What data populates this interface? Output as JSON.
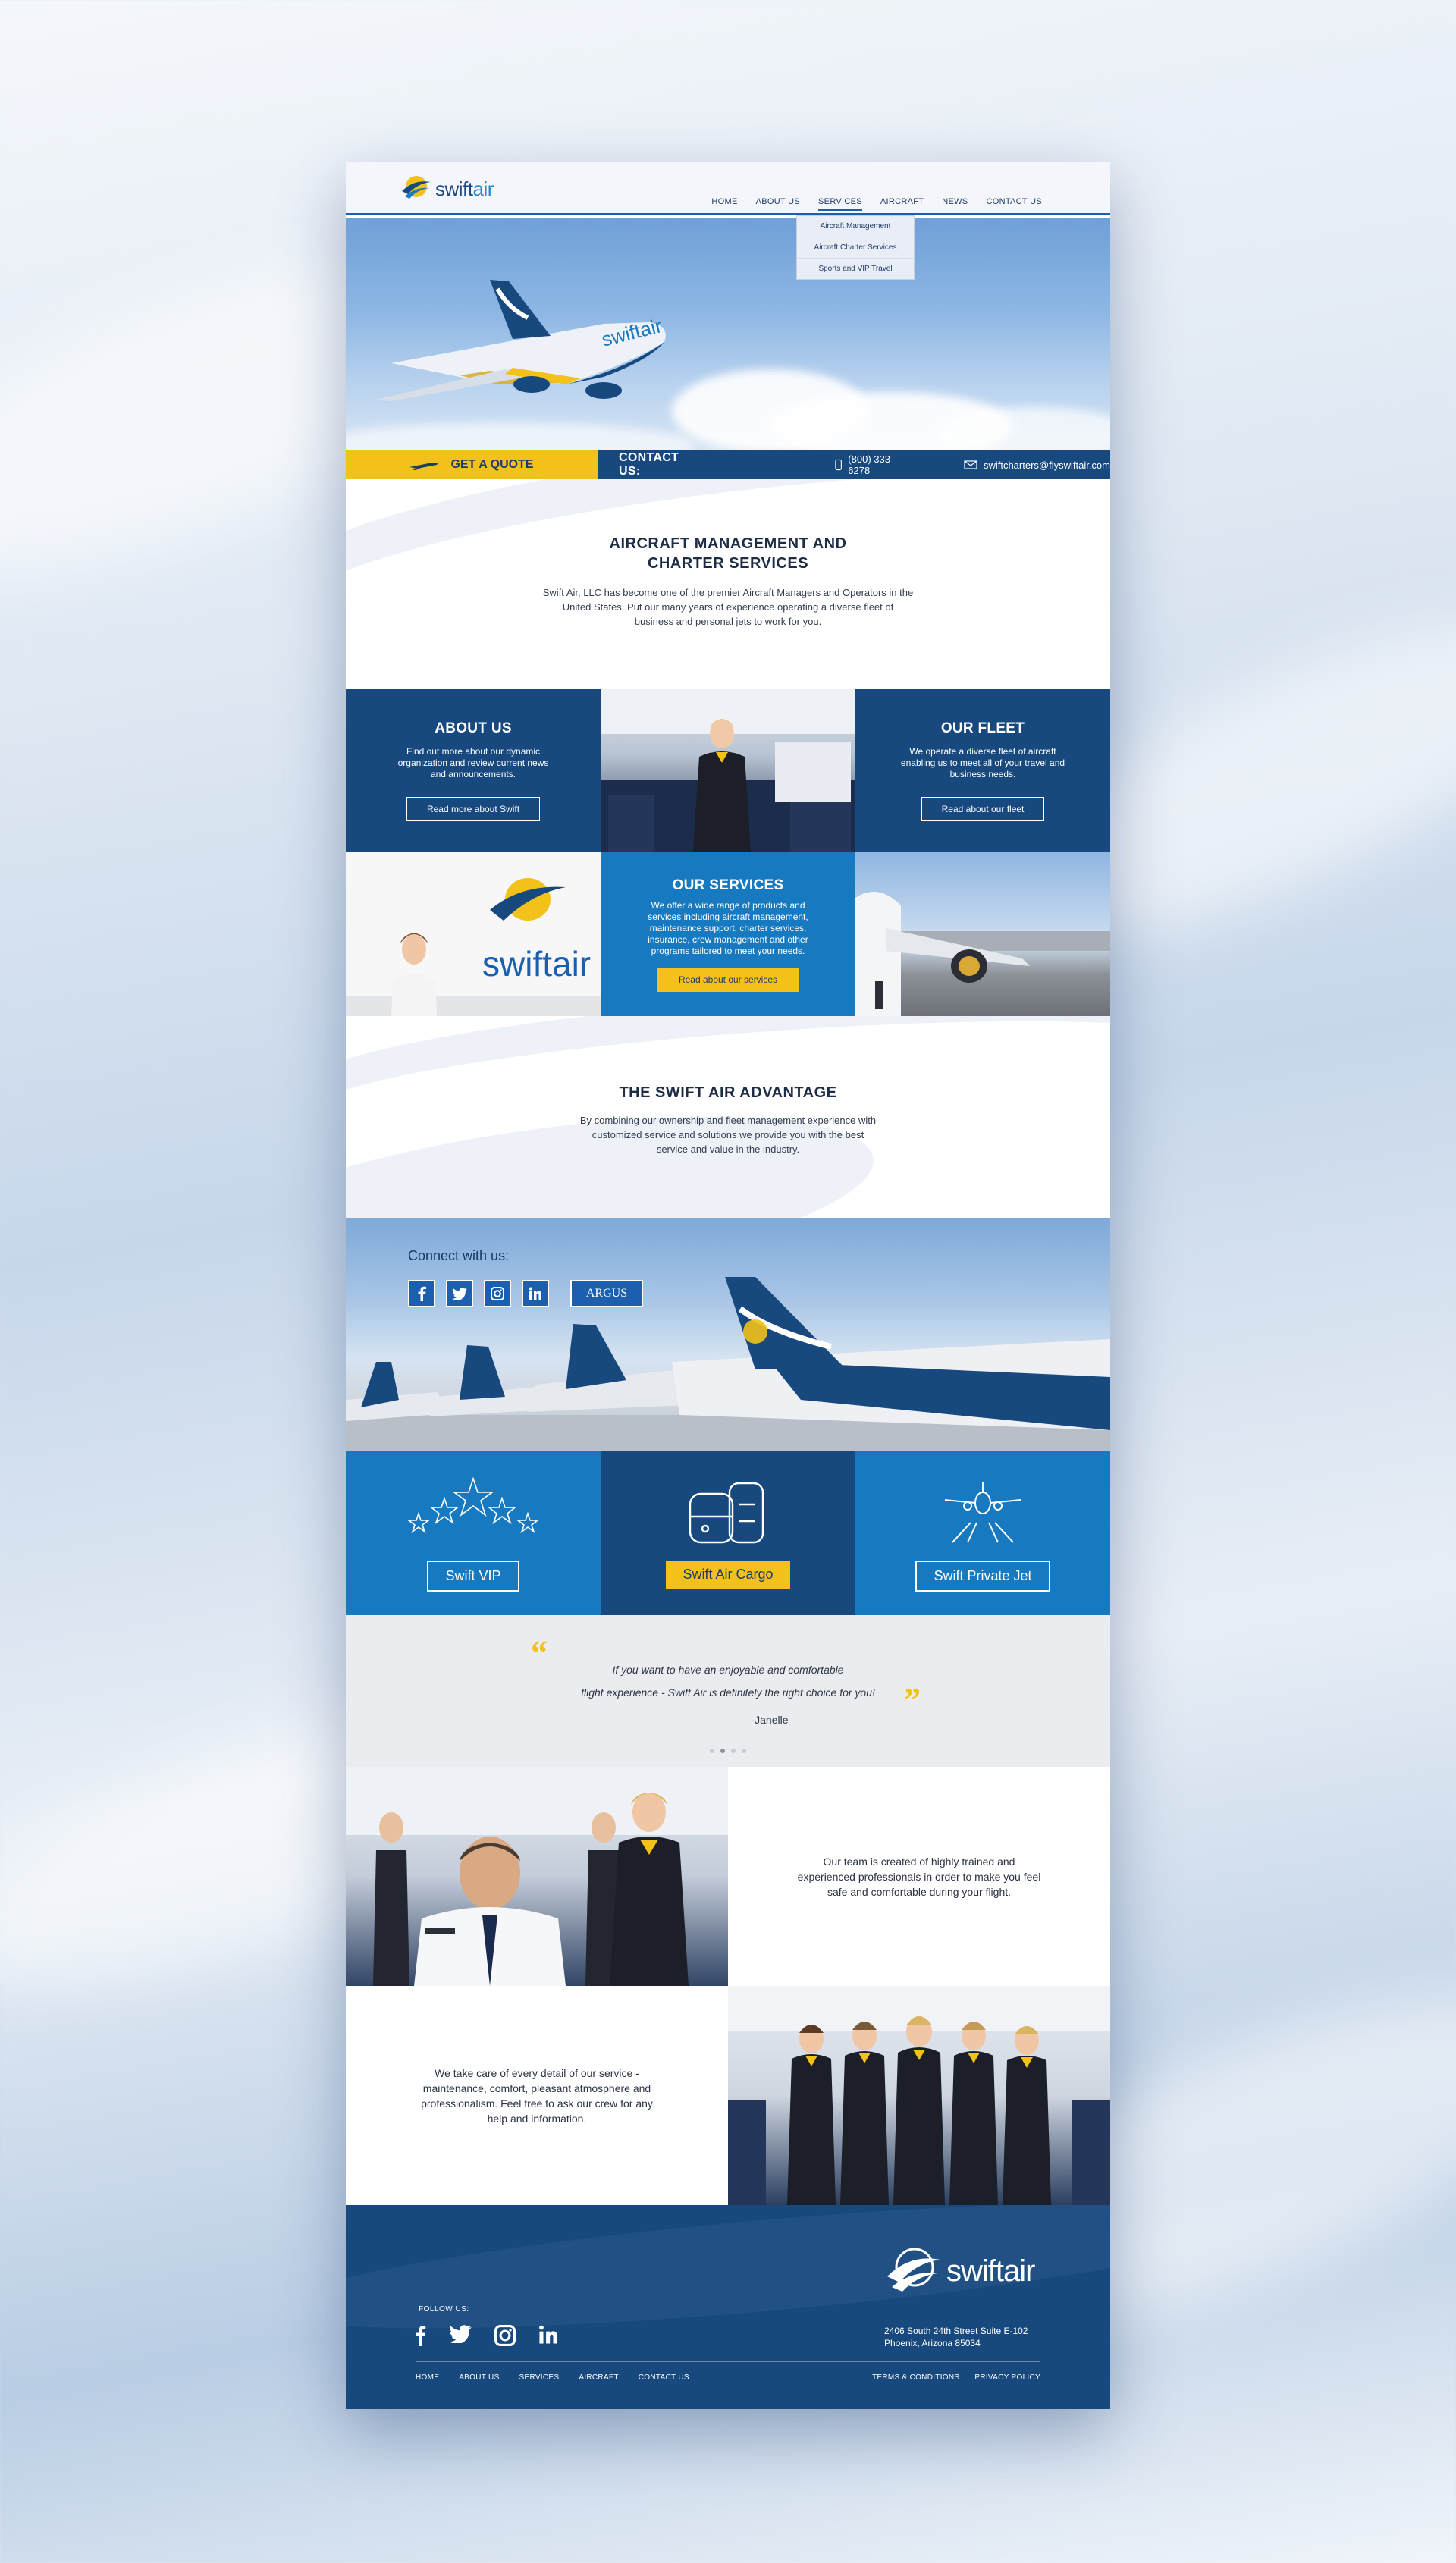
{
  "brand": {
    "name_prefix": "swift",
    "name_suffix": "air"
  },
  "nav": [
    "HOME",
    "ABOUT US",
    "SERVICES",
    "AIRCRAFT",
    "NEWS",
    "CONTACT US"
  ],
  "services_menu": [
    "Aircraft Management",
    "Aircraft Charter Services",
    "Sports and VIP Travel"
  ],
  "hero": {
    "plane_livery": "swiftair"
  },
  "quote_bar": {
    "quote_label": "GET A QUOTE",
    "contact_label": "CONTACT US:",
    "phone": "(800) 333-6278",
    "email": "swiftcharters@flyswiftair.com"
  },
  "intro": {
    "title_line1": "AIRCRAFT MANAGEMENT AND",
    "title_line2": "CHARTER SERVICES",
    "text_line1": "Swift Air, LLC has become one of the premier Aircraft Managers and Operators in the",
    "text_line2": "United States. Put our many years of experience operating a diverse fleet of",
    "text_line3": "business and personal jets to work for you."
  },
  "about": {
    "title": "ABOUT US",
    "text": "Find out more about our dynamic organization and review current news and announcements.",
    "button": "Read more about Swift"
  },
  "fleet": {
    "title": "OUR FLEET",
    "text": "We operate a diverse fleet of aircraft enabling us to meet all of your travel and business needs.",
    "button": "Read about our fleet"
  },
  "services": {
    "title": "OUR SERVICES",
    "text": "We offer a wide range of products and services including aircraft management, maintenance support, charter services, insurance, crew management and other programs tailored to meet your needs.",
    "button": "Read about our services"
  },
  "advantage": {
    "title": "THE SWIFT AIR ADVANTAGE",
    "text_line1": "By combining our ownership and fleet management experience with",
    "text_line2": "customized service and solutions we provide you with the best",
    "text_line3": "service and value in the industry."
  },
  "connect": {
    "title": "Connect with us:",
    "argus": "ARGUS",
    "social_icons": [
      "facebook-icon",
      "twitter-icon",
      "instagram-icon",
      "linkedin-icon"
    ]
  },
  "service_tiles": [
    {
      "label": "Swift VIP",
      "icon": "stars-icon"
    },
    {
      "label": "Swift Air Cargo",
      "icon": "cargo-icon"
    },
    {
      "label": "Swift Private Jet",
      "icon": "private-jet-icon"
    }
  ],
  "testimonial": {
    "line1": "If you want to have an enjoyable and comfortable",
    "line2": "flight experience - Swift Air is definitely the right choice for you!",
    "author": "-Janelle",
    "slide_count": 4,
    "active_slide": 2
  },
  "team": {
    "text1": "Our team is created of highly trained and experienced professionals in order to make you feel safe and comfortable during your flight.",
    "text2": "We take care of every detail of our service - maintenance, comfort, pleasant atmosphere and professionalism. Feel free to ask our crew for any help and information."
  },
  "footer": {
    "follow": "FOLLOW US:",
    "address_line1": "2406 South 24th Street Suite E-102",
    "address_line2": "Phoenix, Arizona 85034",
    "links": [
      "HOME",
      "ABOUT US",
      "SERVICES",
      "AIRCRAFT",
      "CONTACT US"
    ],
    "legal": [
      "TERMS & CONDITIONS",
      "PRIVACY POLICY"
    ]
  },
  "colors": {
    "navy": "#17497f",
    "blue": "#1779c0",
    "yellow": "#f2c11a",
    "grey": "#ebecef"
  }
}
